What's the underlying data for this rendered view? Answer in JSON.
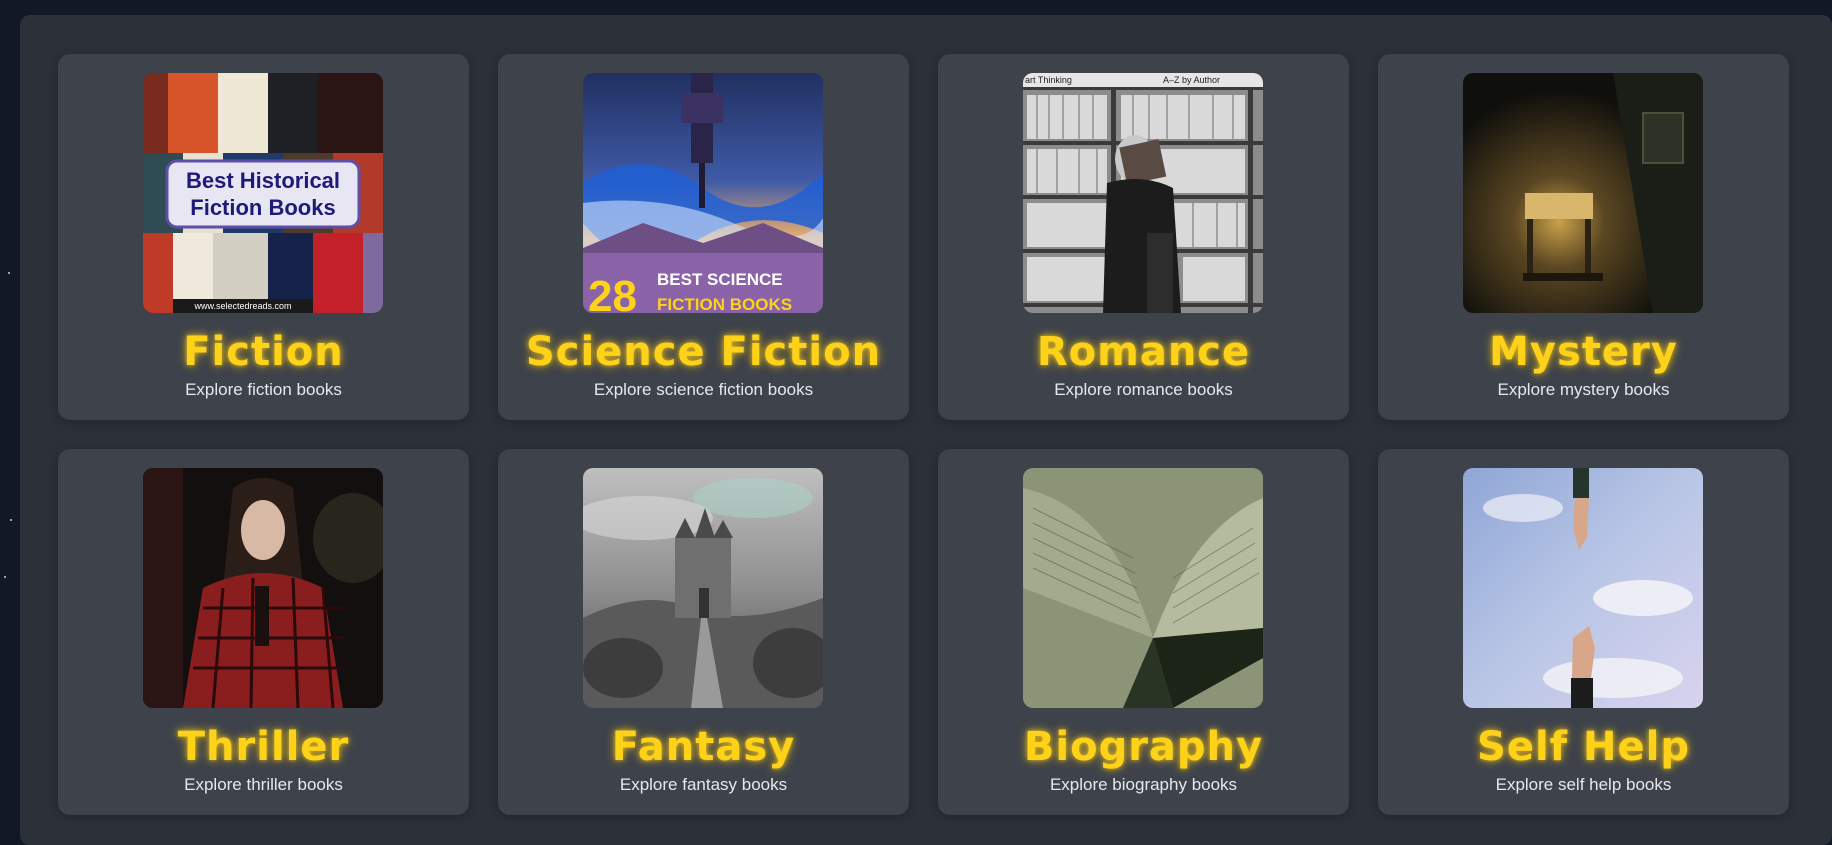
{
  "categories": [
    {
      "title": "Fiction",
      "subtitle": "Explore fiction books",
      "image": "historical-fiction-book-collage",
      "image_text": {
        "line1": "Best Historical",
        "line2": "Fiction Books",
        "footer": "www.selectedreads.com"
      }
    },
    {
      "title": "Science Fiction",
      "subtitle": "Explore science fiction books",
      "image": "sci-fi-floating-city-poster",
      "image_text": {
        "number": "28",
        "line1": "BEST SCIENCE",
        "line2": "FICTION BOOKS"
      }
    },
    {
      "title": "Romance",
      "subtitle": "Explore romance books",
      "image": "couple-kissing-behind-book-in-library",
      "image_text": {
        "left": "art Thinking",
        "right": "A–Z by Author"
      }
    },
    {
      "title": "Mystery",
      "subtitle": "Explore mystery books",
      "image": "dark-room-lamp-desk"
    },
    {
      "title": "Thriller",
      "subtitle": "Explore thriller books",
      "image": "woman-in-red-plaid-shirt"
    },
    {
      "title": "Fantasy",
      "subtitle": "Explore fantasy books",
      "image": "castle-on-hill-monochrome"
    },
    {
      "title": "Biography",
      "subtitle": "Explore biography books",
      "image": "open-book-pages"
    },
    {
      "title": "Self Help",
      "subtitle": "Explore self help books",
      "image": "reaching-hands-sky"
    }
  ],
  "colors": {
    "page_background": "#111826",
    "panel_background": "#2c3039",
    "card_background": "#3d424b",
    "title_accent": "#ffd21a",
    "subtitle_text": "#e6e8ec"
  }
}
